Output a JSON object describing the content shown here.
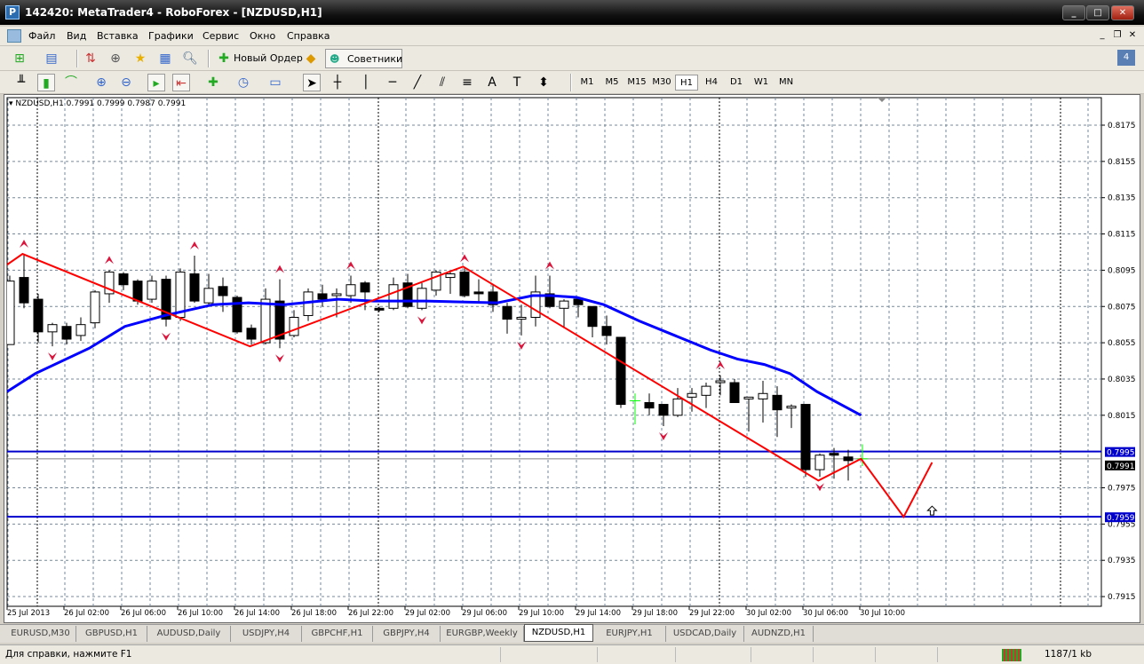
{
  "window": {
    "title": "142420: MetaTrader4 - RoboForex - [NZDUSD,H1]",
    "minimize": "_",
    "maximize": "□",
    "close": "✕"
  },
  "menu": [
    "Файл",
    "Вид",
    "Вставка",
    "Графики",
    "Сервис",
    "Окно",
    "Справка"
  ],
  "toolbar": {
    "new_order": "Новый Ордер",
    "experts": "Советники"
  },
  "timeframes": [
    "M1",
    "M5",
    "M15",
    "M30",
    "H1",
    "H4",
    "D1",
    "W1",
    "MN"
  ],
  "active_timeframe": "H1",
  "chart": {
    "header": "NZDUSD,H1  0.7991 0.7999 0.7987 0.7991",
    "price_ticks": [
      "0.8175",
      "0.8155",
      "0.8135",
      "0.8115",
      "0.8095",
      "0.8075",
      "0.8055",
      "0.8035",
      "0.8015",
      "0.7975",
      "0.7955",
      "0.7935",
      "0.7915"
    ],
    "time_labels": [
      "25 Jul 2013",
      "26 Jul 02:00",
      "26 Jul 06:00",
      "26 Jul 10:00",
      "26 Jul 14:00",
      "26 Jul 18:00",
      "26 Jul 22:00",
      "29 Jul 02:00",
      "29 Jul 06:00",
      "29 Jul 10:00",
      "29 Jul 14:00",
      "29 Jul 18:00",
      "29 Jul 22:00",
      "30 Jul 02:00",
      "30 Jul 06:00",
      "30 Jul 10:00"
    ],
    "level_labels": {
      "upper": "0.7995",
      "bid": "0.7991",
      "lower": "0.7959"
    },
    "colors": {
      "bull": "#ffffff",
      "bear": "#000000",
      "ma": "#0000ff",
      "zigzag": "#ff0000",
      "fractal": "#dc143c",
      "level": "#0000cc"
    }
  },
  "chart_data": {
    "type": "candlestick",
    "symbol": "NZDUSD",
    "timeframe": "H1",
    "ylim": [
      0.7905,
      0.8185
    ],
    "ohlc": [
      [
        0.8054,
        0.8092,
        0.8054,
        0.8089
      ],
      [
        0.8091,
        0.8104,
        0.8074,
        0.8077
      ],
      [
        0.8079,
        0.8082,
        0.8055,
        0.8061
      ],
      [
        0.8061,
        0.8066,
        0.8053,
        0.8065
      ],
      [
        0.8064,
        0.8066,
        0.8054,
        0.8057
      ],
      [
        0.8059,
        0.8069,
        0.8056,
        0.8065
      ],
      [
        0.8066,
        0.8084,
        0.8063,
        0.8083
      ],
      [
        0.8082,
        0.8095,
        0.8077,
        0.8094
      ],
      [
        0.8093,
        0.8094,
        0.8084,
        0.8087
      ],
      [
        0.8089,
        0.809,
        0.8076,
        0.8078
      ],
      [
        0.8079,
        0.8092,
        0.8077,
        0.8089
      ],
      [
        0.809,
        0.8092,
        0.8064,
        0.8068
      ],
      [
        0.8069,
        0.8096,
        0.8067,
        0.8094
      ],
      [
        0.8093,
        0.8103,
        0.8077,
        0.8078
      ],
      [
        0.8077,
        0.8093,
        0.8075,
        0.8085
      ],
      [
        0.8086,
        0.8091,
        0.8072,
        0.8081
      ],
      [
        0.808,
        0.8081,
        0.806,
        0.8061
      ],
      [
        0.8063,
        0.8065,
        0.8054,
        0.8057
      ],
      [
        0.8055,
        0.8085,
        0.8054,
        0.8079
      ],
      [
        0.8078,
        0.809,
        0.8052,
        0.8057
      ],
      [
        0.8059,
        0.8073,
        0.8058,
        0.8069
      ],
      [
        0.807,
        0.8085,
        0.8067,
        0.8083
      ],
      [
        0.8082,
        0.8087,
        0.8075,
        0.8079
      ],
      [
        0.8081,
        0.8085,
        0.8069,
        0.8082
      ],
      [
        0.8081,
        0.8092,
        0.8077,
        0.8087
      ],
      [
        0.8088,
        0.8089,
        0.8073,
        0.8083
      ],
      [
        0.8074,
        0.8075,
        0.8072,
        0.8073
      ],
      [
        0.8074,
        0.8091,
        0.8073,
        0.8087
      ],
      [
        0.8088,
        0.8093,
        0.8074,
        0.8075
      ],
      [
        0.8074,
        0.8088,
        0.8073,
        0.8085
      ],
      [
        0.8084,
        0.8095,
        0.8081,
        0.8094
      ],
      [
        0.8091,
        0.8094,
        0.8082,
        0.8093
      ],
      [
        0.8094,
        0.8096,
        0.808,
        0.8081
      ],
      [
        0.8083,
        0.809,
        0.8077,
        0.8082
      ],
      [
        0.8083,
        0.8087,
        0.8072,
        0.8076
      ],
      [
        0.8075,
        0.8077,
        0.806,
        0.8068
      ],
      [
        0.8068,
        0.8076,
        0.8059,
        0.8069
      ],
      [
        0.8069,
        0.8092,
        0.8064,
        0.8083
      ],
      [
        0.8082,
        0.8092,
        0.8074,
        0.8075
      ],
      [
        0.8074,
        0.8079,
        0.8063,
        0.8078
      ],
      [
        0.8079,
        0.8079,
        0.8069,
        0.8076
      ],
      [
        0.8075,
        0.8075,
        0.8058,
        0.8064
      ],
      [
        0.8064,
        0.807,
        0.8054,
        0.8059
      ],
      [
        0.8058,
        0.8058,
        0.8019,
        0.8021
      ],
      [
        0.8023,
        0.8027,
        0.801,
        0.8023
      ],
      [
        0.8022,
        0.8027,
        0.8015,
        0.8019
      ],
      [
        0.8021,
        0.8021,
        0.8009,
        0.8015
      ],
      [
        0.8015,
        0.803,
        0.8014,
        0.8024
      ],
      [
        0.8025,
        0.803,
        0.8017,
        0.8027
      ],
      [
        0.8026,
        0.8033,
        0.8019,
        0.8031
      ],
      [
        0.8033,
        0.8037,
        0.8026,
        0.8034
      ],
      [
        0.8033,
        0.8035,
        0.8022,
        0.8022
      ],
      [
        0.8024,
        0.8025,
        0.8006,
        0.8025
      ],
      [
        0.8024,
        0.8034,
        0.8011,
        0.8027
      ],
      [
        0.8026,
        0.8031,
        0.8003,
        0.8018
      ],
      [
        0.8019,
        0.8021,
        0.8008,
        0.802
      ],
      [
        0.8021,
        0.8021,
        0.7981,
        0.7985
      ],
      [
        0.7985,
        0.7994,
        0.7981,
        0.7993
      ],
      [
        0.7994,
        0.7997,
        0.798,
        0.7993
      ],
      [
        0.7992,
        0.7996,
        0.7979,
        0.799
      ],
      [
        0.7991,
        0.7999,
        0.7987,
        0.7991
      ]
    ],
    "moving_average": [
      [
        -0.2,
        0.8028
      ],
      [
        1.8,
        0.8038
      ],
      [
        5.6,
        0.8052
      ],
      [
        8.1,
        0.8064
      ],
      [
        10.9,
        0.807
      ],
      [
        14.3,
        0.8076
      ],
      [
        16.8,
        0.8077
      ],
      [
        19.3,
        0.8076
      ],
      [
        23.1,
        0.8079
      ],
      [
        25.6,
        0.8078
      ],
      [
        29.3,
        0.8078
      ],
      [
        34.3,
        0.8077
      ],
      [
        36.8,
        0.8081
      ],
      [
        38.1,
        0.8081
      ],
      [
        39.9,
        0.808
      ],
      [
        41.8,
        0.8076
      ],
      [
        44.3,
        0.8067
      ],
      [
        46.8,
        0.8059
      ],
      [
        49.3,
        0.8051
      ],
      [
        51.2,
        0.8046
      ],
      [
        53.1,
        0.8043
      ],
      [
        54.9,
        0.8038
      ],
      [
        56.8,
        0.8028
      ],
      [
        59.9,
        0.8015
      ]
    ],
    "zigzag": [
      [
        -0.2,
        0.8098
      ],
      [
        0.9,
        0.8104
      ],
      [
        16.9,
        0.8053
      ],
      [
        31.9,
        0.8097
      ],
      [
        56.9,
        0.7979
      ],
      [
        59.9,
        0.7991
      ],
      [
        62.9,
        0.7959
      ],
      [
        64.9,
        0.7989
      ]
    ],
    "fractals_up": [
      1,
      7,
      13,
      19,
      24,
      32,
      38,
      50
    ],
    "fractals_down": [
      3,
      11,
      19,
      29,
      36,
      46,
      57
    ],
    "levels": {
      "upper": 0.7995,
      "bid": 0.7991,
      "lower": 0.7959
    },
    "arrow_marker": [
      64.9,
      0.7959
    ]
  },
  "tabs": [
    "EURUSD,M30",
    "GBPUSD,H1",
    "AUDUSD,Daily",
    "USDJPY,H4",
    "GBPCHF,H1",
    "GBPJPY,H4",
    "EURGBP,Weekly",
    "NZDUSD,H1",
    "EURJPY,H1",
    "USDCAD,Daily",
    "AUDNZD,H1"
  ],
  "active_tab": "NZDUSD,H1",
  "status": {
    "help": "Для справки, нажмите F1",
    "traffic": "1187/1 kb"
  }
}
